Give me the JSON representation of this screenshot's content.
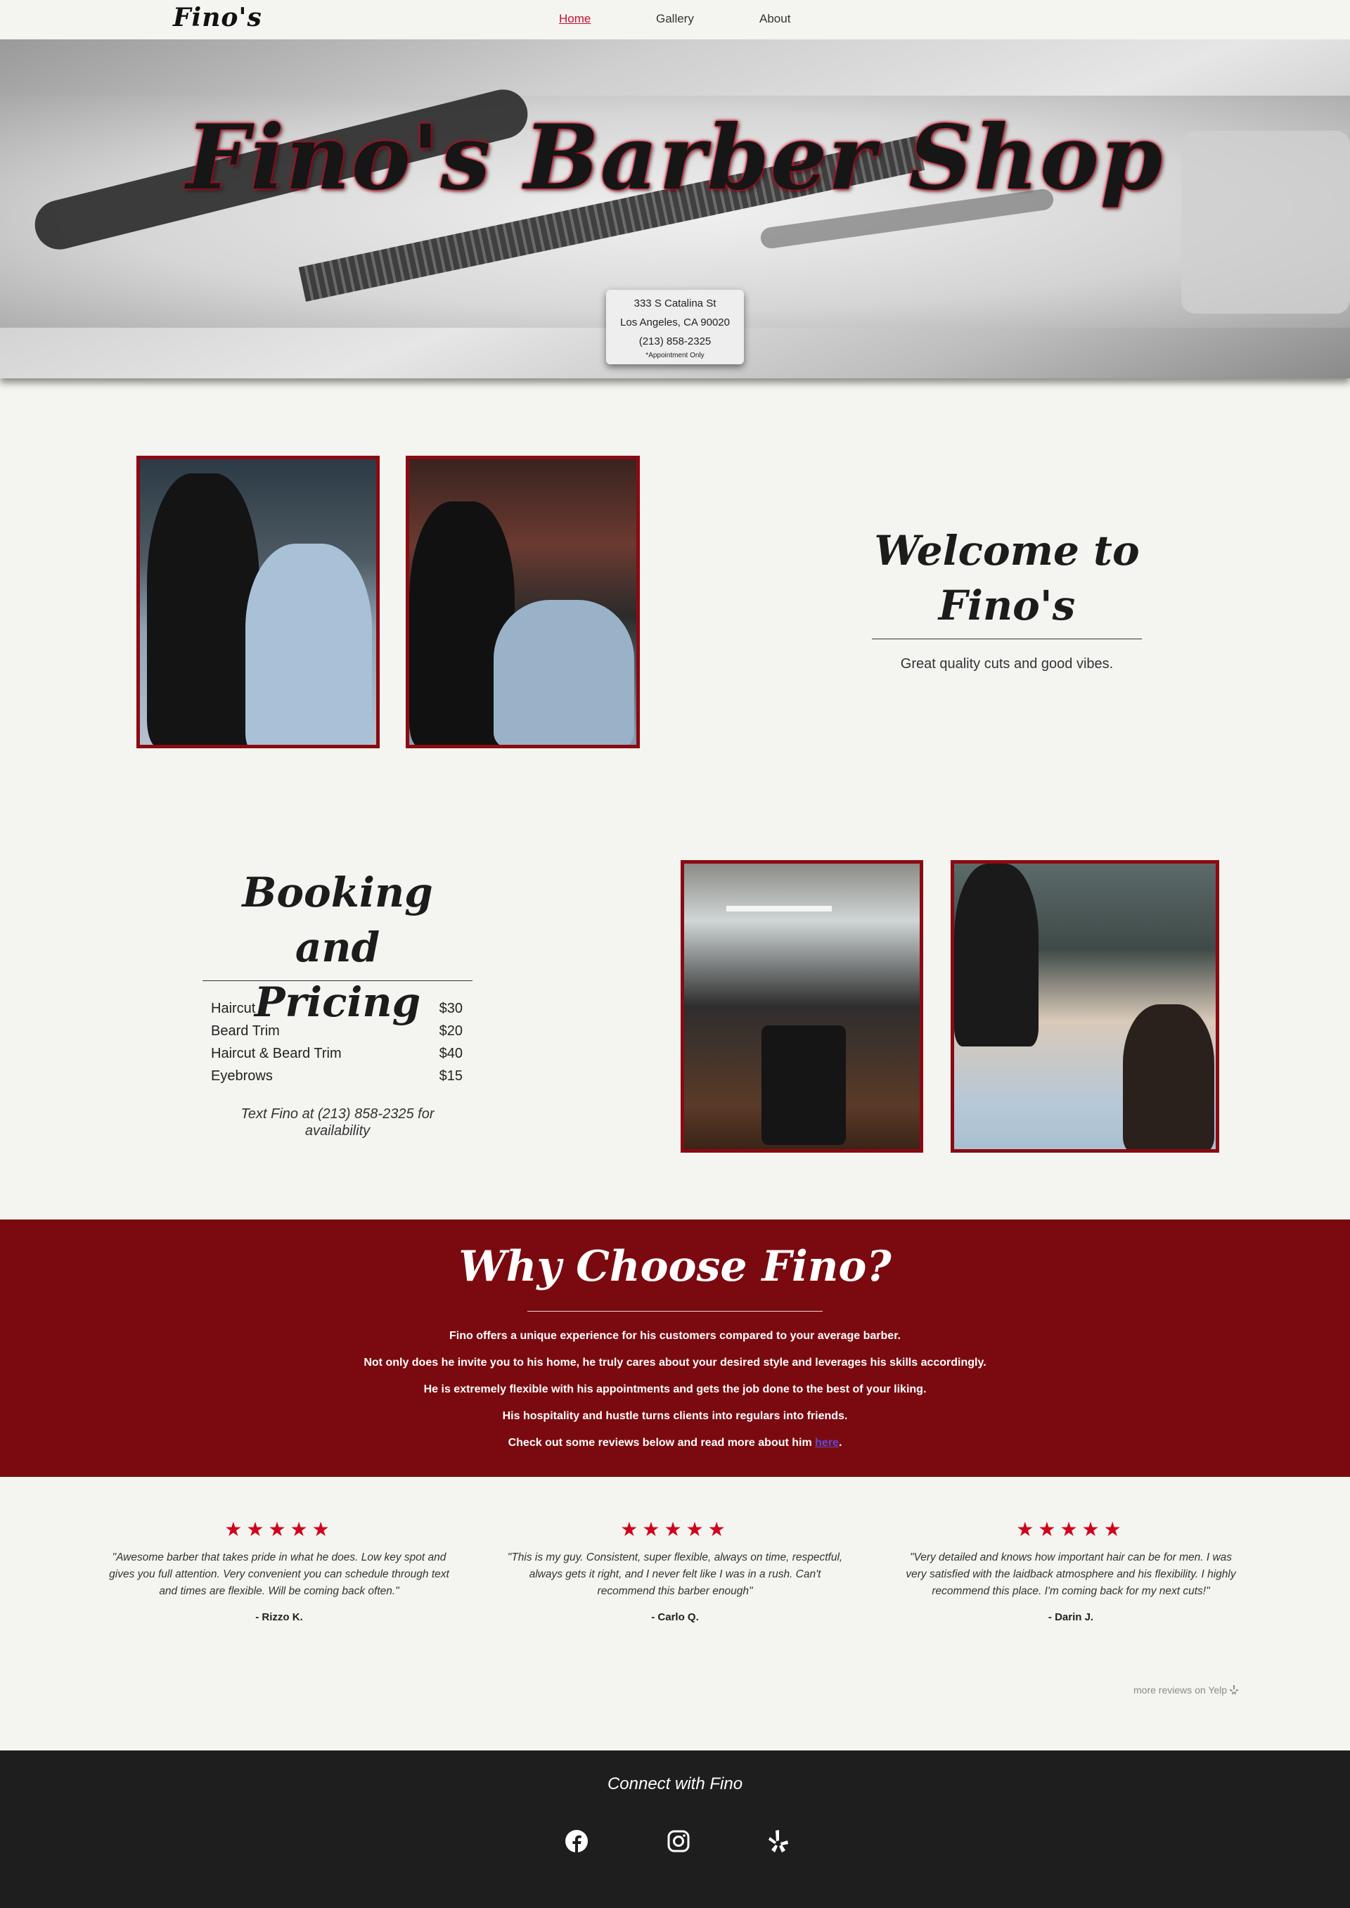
{
  "nav": {
    "logo": "Fino's",
    "links": [
      "Home",
      "Gallery",
      "About"
    ]
  },
  "hero": {
    "title": "Fino's Barber Shop",
    "address_line1": "333 S Catalina St",
    "address_line2": "Los Angeles, CA 90020",
    "phone": "(213) 858-2325",
    "note": "*Appointment Only"
  },
  "welcome": {
    "title_line1": "Welcome to",
    "title_line2": "Fino's",
    "subtitle": "Great quality cuts and good vibes."
  },
  "booking": {
    "title_line1": "Booking and",
    "title_line2": "Pricing",
    "items": [
      {
        "name": "Haircut",
        "price": "$30"
      },
      {
        "name": "Beard Trim",
        "price": "$20"
      },
      {
        "name": "Haircut & Beard Trim",
        "price": "$40"
      },
      {
        "name": "Eyebrows",
        "price": "$15"
      }
    ],
    "note": "Text Fino at (213) 858-2325 for availability"
  },
  "why": {
    "title": "Why Choose Fino?",
    "lines": [
      "Fino offers a unique experience for his customers compared to your average barber.",
      "Not only does he invite you to his home, he truly cares about your desired style and leverages his skills accordingly.",
      "He is extremely flexible with his appointments and gets the job done to the best of your liking.",
      "His hospitality and hustle turns clients into regulars into friends."
    ],
    "last_line_prefix": "Check out some reviews below and read more about him ",
    "last_line_link": "here",
    "last_line_suffix": "."
  },
  "reviews": [
    {
      "stars": "★★★★★",
      "rating": 5,
      "quote": "\"Awesome barber that takes pride in what he does. Low key spot and gives you full attention. Very convenient you can schedule through text and times are flexible. Will be coming back often.\"",
      "author": "- Rizzo K."
    },
    {
      "stars": "★★★★★",
      "rating": 5,
      "quote": "\"This is my guy. Consistent, super flexible, always on time, respectful, always gets it right, and I never felt like I was in a rush. Can't recommend this barber enough\"",
      "author": "- Carlo Q."
    },
    {
      "stars": "★★★★★",
      "rating": 5,
      "quote": "\"Very detailed and knows how important hair can be for men. I was very satisfied with the laidback atmosphere and his flexibility. I highly recommend this place. I'm coming back for my next cuts!\"",
      "author": "- Darin J."
    }
  ],
  "more_reviews": "more reviews on Yelp",
  "footer": {
    "title": "Connect with Fino",
    "icons": [
      "facebook-icon",
      "instagram-icon",
      "yelp-icon"
    ]
  },
  "colors": {
    "accent_red": "#c8102e",
    "frame_red": "#8b0a12",
    "why_bg": "#7b0a10",
    "footer_bg": "#1e1e1e",
    "page_bg": "#f4f4f0"
  }
}
